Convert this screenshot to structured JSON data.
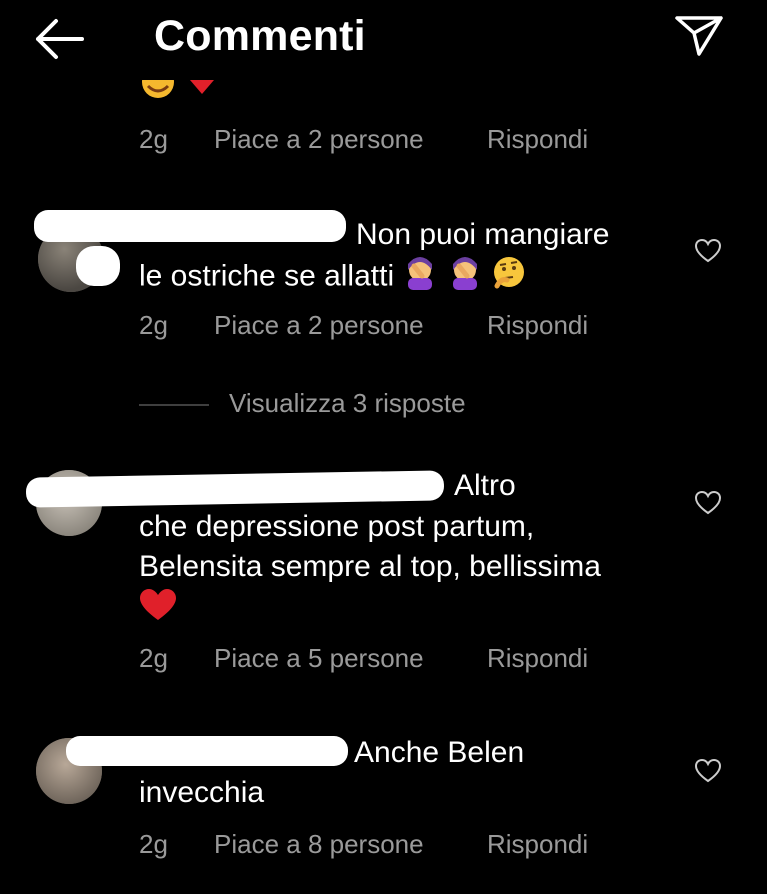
{
  "header": {
    "title": "Commenti",
    "back_icon": "arrow-left-icon",
    "send_icon": "paper-plane-icon"
  },
  "top_comment_meta": {
    "age": "2g",
    "likes": "Piace a 2 persone",
    "reply": "Rispondi"
  },
  "comments": [
    {
      "text_line1": "Non puoi mangiare",
      "text_line2": "le ostriche se allatti",
      "emojis": [
        "woman-facepalming",
        "woman-facepalming",
        "thinking-face"
      ],
      "age": "2g",
      "likes": "Piace a 2 persone",
      "reply": "Rispondi"
    },
    {
      "text_line1": "Altro",
      "text_line2": "che depressione post partum,",
      "text_line3": "Belensita sempre al top, bellissima",
      "emojis": [
        "red-heart"
      ],
      "age": "2g",
      "likes": "Piace a 5 persone",
      "reply": "Rispondi"
    },
    {
      "text_line1": "Anche Belen",
      "text_line2": "invecchia",
      "age": "2g",
      "likes": "Piace a 8 persone",
      "reply": "Rispondi"
    }
  ],
  "view_replies": "Visualizza 3 risposte",
  "colors": {
    "background": "#000000",
    "text": "#ffffff",
    "meta": "#9a9a9a",
    "heart": "#e0202a"
  }
}
